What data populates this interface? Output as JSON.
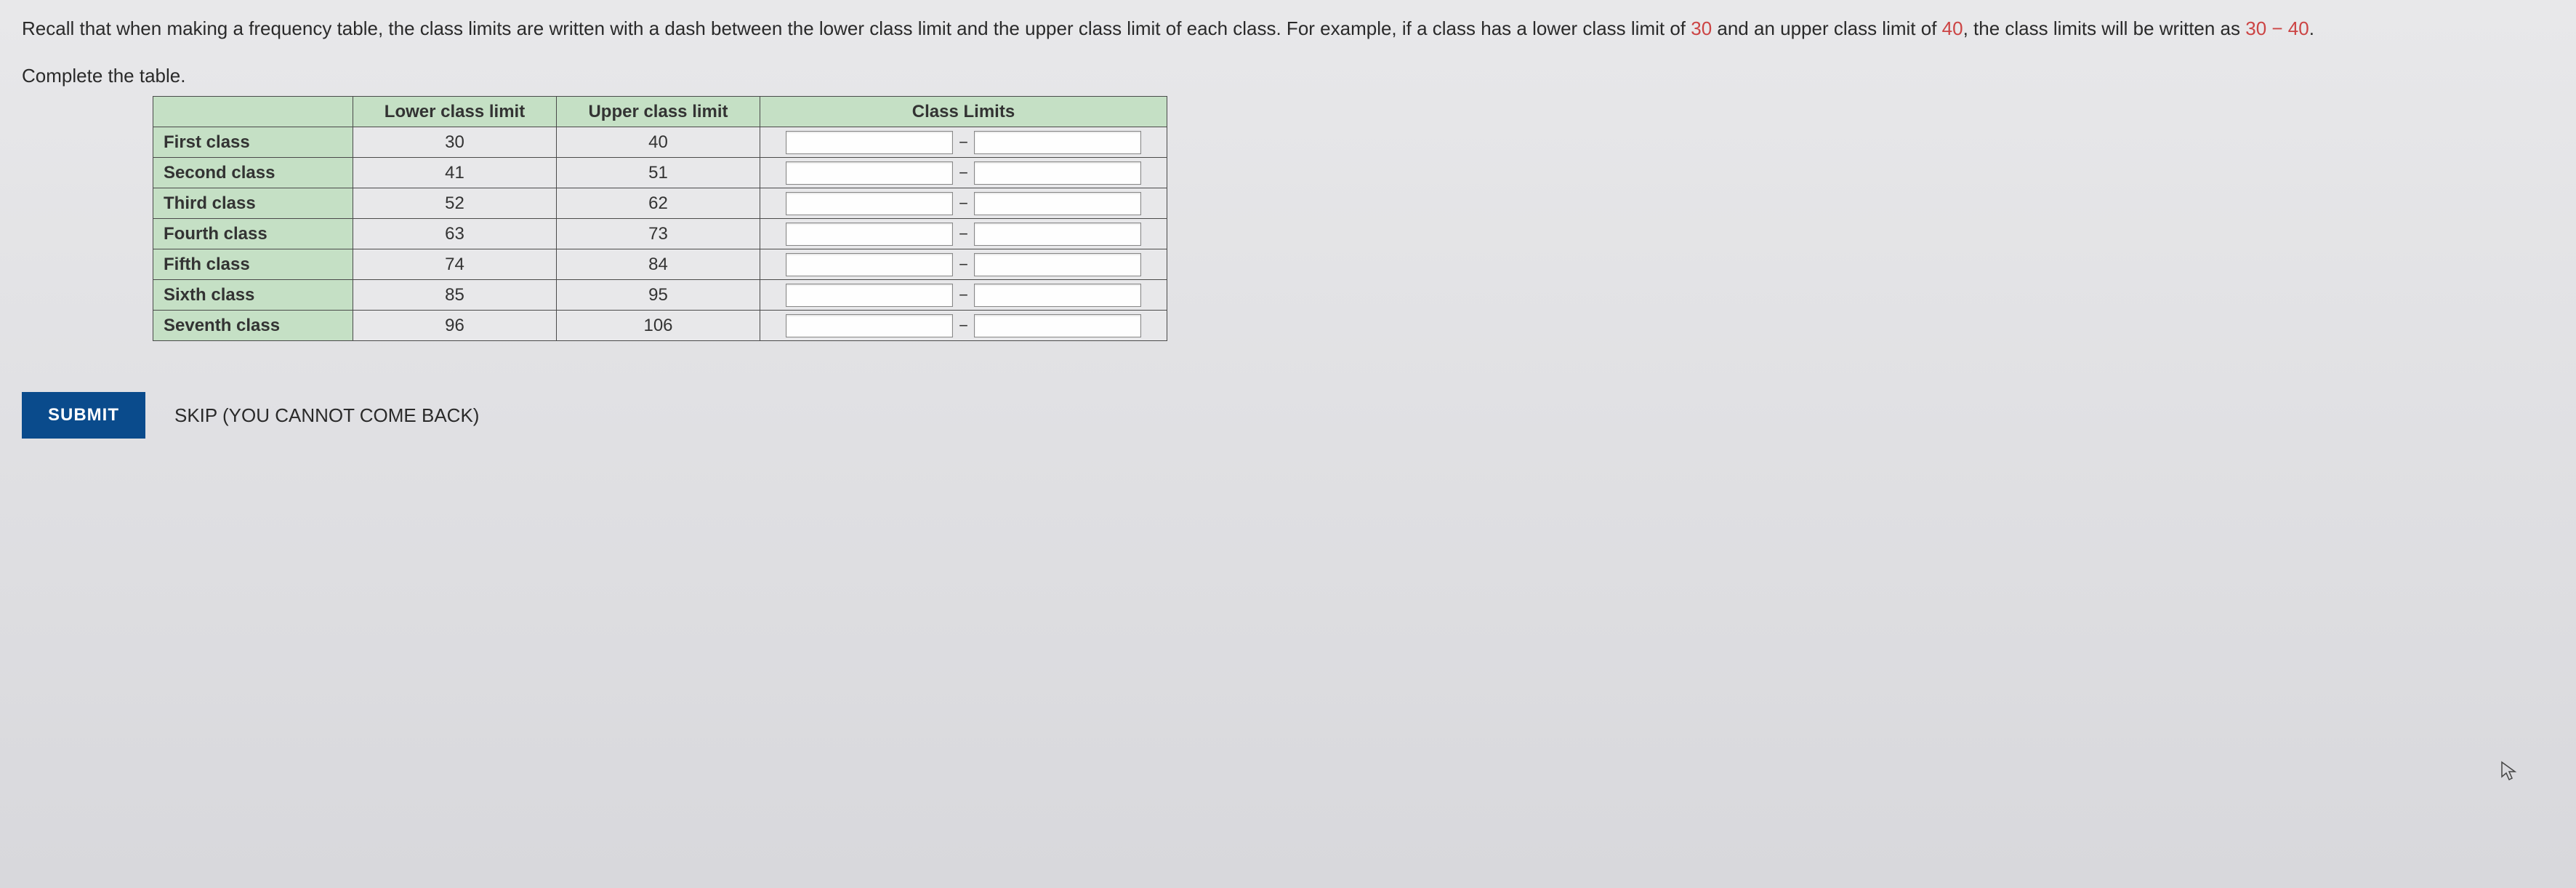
{
  "instructions": {
    "pre1": "Recall that when making a frequency table, the class limits are written with a dash between the lower class limit and the upper class limit of each class. For example, if a class has a lower class limit of ",
    "num1": "30",
    "mid1": " and an upper class limit of ",
    "num2": "40",
    "mid2": ", the class limits will be written as ",
    "expr": "30 − 40",
    "end": "."
  },
  "prompt": "Complete the table.",
  "headers": {
    "lower": "Lower class limit",
    "upper": "Upper class limit",
    "limits": "Class Limits"
  },
  "rows": [
    {
      "label": "First class",
      "lower": "30",
      "upper": "40"
    },
    {
      "label": "Second class",
      "lower": "41",
      "upper": "51"
    },
    {
      "label": "Third class",
      "lower": "52",
      "upper": "62"
    },
    {
      "label": "Fourth class",
      "lower": "63",
      "upper": "73"
    },
    {
      "label": "Fifth class",
      "lower": "74",
      "upper": "84"
    },
    {
      "label": "Sixth class",
      "lower": "85",
      "upper": "95"
    },
    {
      "label": "Seventh class",
      "lower": "96",
      "upper": "106"
    }
  ],
  "dash": "−",
  "actions": {
    "submit": "SUBMIT",
    "skip": "SKIP (YOU CANNOT COME BACK)"
  }
}
